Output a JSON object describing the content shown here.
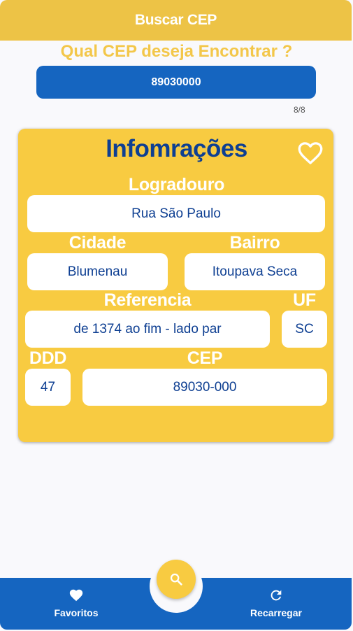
{
  "appbar": {
    "title": "Buscar CEP"
  },
  "search": {
    "question": "Qual CEP deseja Encontrar ?",
    "value": "89030000",
    "counter": "8/8"
  },
  "card": {
    "title": "Infomrações",
    "favorite_icon": "heart-outline-icon",
    "fields": {
      "logradouro": {
        "label": "Logradouro",
        "value": "Rua São Paulo"
      },
      "cidade": {
        "label": "Cidade",
        "value": "Blumenau"
      },
      "bairro": {
        "label": "Bairro",
        "value": "Itoupava Seca"
      },
      "referencia": {
        "label": "Referencia",
        "value": "de 1374 ao fim - lado par"
      },
      "uf": {
        "label": "UF",
        "value": "SC"
      },
      "ddd": {
        "label": "DDD",
        "value": "47"
      },
      "cep": {
        "label": "CEP",
        "value": "89030-000"
      }
    }
  },
  "bottom_nav": {
    "fab_icon": "search-icon",
    "items": [
      {
        "label": "Favoritos",
        "icon": "heart-icon"
      },
      {
        "label": "Recarregar",
        "icon": "refresh-icon"
      }
    ]
  },
  "colors": {
    "appbar": "#edc346",
    "primary_blue": "#1565c0",
    "card_yellow": "#f8cb41",
    "text_blue": "#0e3f92"
  }
}
